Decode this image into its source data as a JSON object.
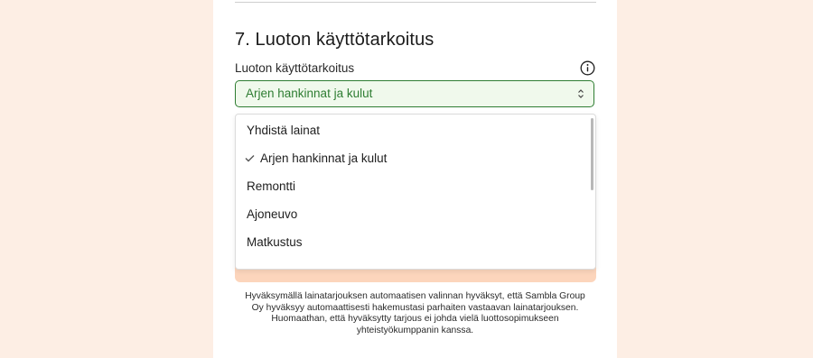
{
  "section": {
    "title": "7. Luoton käyttötarkoitus"
  },
  "purpose_field": {
    "label": "Luoton käyttötarkoitus",
    "selected_value": "Arjen hankinnat ja kulut",
    "info_icon": "info-circle-icon",
    "arrows_icon": "chevron-up-down-icon"
  },
  "dropdown": {
    "options": [
      {
        "label": "Yhdistä lainat",
        "selected": false
      },
      {
        "label": "Arjen hankinnat ja kulut",
        "selected": true
      },
      {
        "label": "Remontti",
        "selected": false
      },
      {
        "label": "Ajoneuvo",
        "selected": false
      },
      {
        "label": "Matkustus",
        "selected": false
      }
    ],
    "check_icon": "checkmark-icon"
  },
  "disclaimer": {
    "line1": "Hyväksymällä lainatarjouksen automaatisen valinnan hyväksyt, että Sambla Group",
    "line2": "Oy hyväksyy automaattisesti hakemustasi parhaiten vastaavan lainatarjouksen.",
    "line3": "Huomaathan, että hyväksytty tarjous ei johda vielä luottosopimukseen",
    "line4": "yhteistyökumppanin kanssa."
  },
  "colors": {
    "page_background": "#fdeee4",
    "accent_green": "#2e7d32",
    "select_background": "#f0f9ec",
    "notice_background": "#fcd5bc"
  }
}
